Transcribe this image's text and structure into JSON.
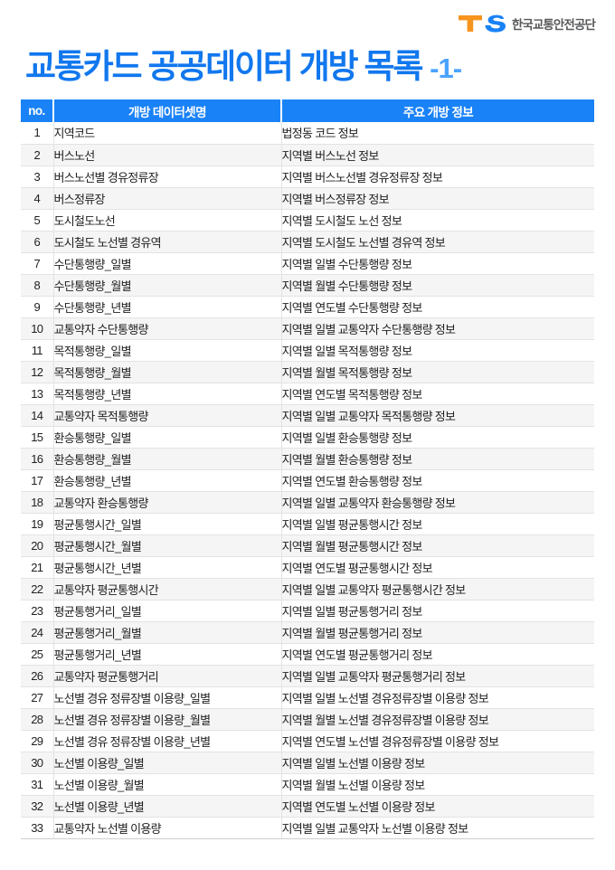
{
  "logo": {
    "mark_t": "T",
    "mark_s": "S",
    "org_name": "한국교통안전공단",
    "color_t": "#F7941E",
    "color_s": "#1a82f7"
  },
  "title": {
    "main": "교통카드 공공데이터 개방 목록",
    "suffix": "-1-",
    "color": "#1177ee",
    "suffix_color": "#4aa3ff"
  },
  "table": {
    "header_color": "#1a82f7",
    "columns": [
      "no.",
      "개방 데이터셋명",
      "주요 개방 정보"
    ],
    "rows": [
      {
        "no": "1",
        "name": "지역코드",
        "info": "법정동 코드 정보"
      },
      {
        "no": "2",
        "name": "버스노선",
        "info": "지역별 버스노선 정보"
      },
      {
        "no": "3",
        "name": "버스노선별 경유정류장",
        "info": "지역별 버스노선별 경유정류장 정보"
      },
      {
        "no": "4",
        "name": "버스정류장",
        "info": "지역별 버스정류장 정보"
      },
      {
        "no": "5",
        "name": "도시철도노선",
        "info": "지역별 도시철도 노선 정보"
      },
      {
        "no": "6",
        "name": "도시철도 노선별 경유역",
        "info": "지역별 도시철도 노선별 경유역 정보"
      },
      {
        "no": "7",
        "name": "수단통행량_일별",
        "info": "지역별 일별 수단통행량 정보"
      },
      {
        "no": "8",
        "name": "수단통행량_월별",
        "info": "지역별 월별 수단통행량 정보"
      },
      {
        "no": "9",
        "name": "수단통행량_년별",
        "info": "지역별 연도별 수단통행량 정보"
      },
      {
        "no": "10",
        "name": "교통약자 수단통행량",
        "info": "지역별 일별 교통약자 수단통행량 정보"
      },
      {
        "no": "11",
        "name": "목적통행량_일별",
        "info": "지역별 일별 목적통행량 정보"
      },
      {
        "no": "12",
        "name": "목적통행량_월별",
        "info": "지역별 월별 목적통행량 정보"
      },
      {
        "no": "13",
        "name": "목적통행량_년별",
        "info": "지역별 연도별 목적통행량 정보"
      },
      {
        "no": "14",
        "name": "교통약자 목적통행량",
        "info": "지역별 일별 교통약자 목적통행량 정보"
      },
      {
        "no": "15",
        "name": "환승통행량_일별",
        "info": "지역별 일별 환승통행량 정보"
      },
      {
        "no": "16",
        "name": "환승통행량_월별",
        "info": "지역별 월별 환승통행량 정보"
      },
      {
        "no": "17",
        "name": "환승통행량_년별",
        "info": "지역별 연도별 환승통행량 정보"
      },
      {
        "no": "18",
        "name": "교통약자 환승통행량",
        "info": "지역별 일별 교통약자 환승통행량 정보"
      },
      {
        "no": "19",
        "name": "평균통행시간_일별",
        "info": "지역별 일별 평균통행시간 정보"
      },
      {
        "no": "20",
        "name": "평균통행시간_월별",
        "info": "지역별 월별 평균통행시간 정보"
      },
      {
        "no": "21",
        "name": "평균통행시간_년별",
        "info": "지역별 연도별 평균통행시간 정보"
      },
      {
        "no": "22",
        "name": "교통약자 평균통행시간",
        "info": "지역별 일별 교통약자 평균통행시간 정보"
      },
      {
        "no": "23",
        "name": "평균통행거리_일별",
        "info": "지역별 일별 평균통행거리 정보"
      },
      {
        "no": "24",
        "name": "평균통행거리_월별",
        "info": "지역별 월별 평균통행거리 정보"
      },
      {
        "no": "25",
        "name": "평균통행거리_년별",
        "info": "지역별 연도별 평균통행거리 정보"
      },
      {
        "no": "26",
        "name": "교통약자 평균통행거리",
        "info": "지역별 일별 교통약자 평균통행거리 정보"
      },
      {
        "no": "27",
        "name": "노선별 경유 정류장별 이용량_일별",
        "info": "지역별 일별 노선별 경유정류장별 이용량 정보"
      },
      {
        "no": "28",
        "name": "노선별 경유 정류장별 이용량_월별",
        "info": "지역별 월별 노선별 경유정류장별 이용량 정보"
      },
      {
        "no": "29",
        "name": "노선별 경유 정류장별 이용량_년별",
        "info": "지역별 연도별 노선별 경유정류장별 이용량 정보"
      },
      {
        "no": "30",
        "name": "노선별 이용량_일별",
        "info": "지역별 일별 노선별 이용량 정보"
      },
      {
        "no": "31",
        "name": "노선별 이용량_월별",
        "info": "지역별 월별 노선별 이용량 정보"
      },
      {
        "no": "32",
        "name": "노선별 이용량_년별",
        "info": "지역별 연도별 노선별 이용량 정보"
      },
      {
        "no": "33",
        "name": "교통약자 노선별 이용량",
        "info": "지역별 일별 교통약자 노선별 이용량 정보"
      }
    ]
  }
}
